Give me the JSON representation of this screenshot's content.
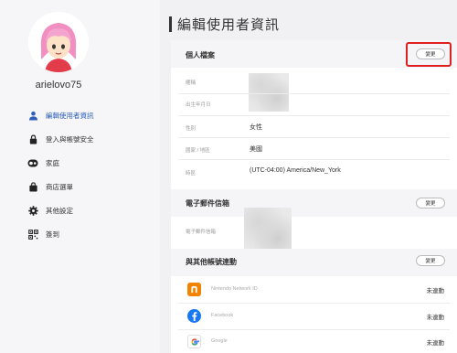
{
  "page_title": "編輯使用者資訊",
  "user": {
    "username": "arielovo75"
  },
  "sidebar": {
    "items": [
      {
        "label": "編輯使用者資訊",
        "icon": "user-icon",
        "active": true
      },
      {
        "label": "登入與帳號安全",
        "icon": "lock-icon",
        "active": false
      },
      {
        "label": "家庭",
        "icon": "family-icon",
        "active": false
      },
      {
        "label": "商店選單",
        "icon": "shopping-bag-icon",
        "active": false
      },
      {
        "label": "其他設定",
        "icon": "gear-icon",
        "active": false
      },
      {
        "label": "簽到",
        "icon": "qr-code-icon",
        "active": false
      }
    ]
  },
  "profile": {
    "title": "個人檔案",
    "edit_label": "變更",
    "rows": [
      {
        "label": "暱稱",
        "value": ""
      },
      {
        "label": "出生年月日",
        "value": ""
      },
      {
        "label": "性別",
        "value": "女性"
      },
      {
        "label": "國家 / 地區",
        "value": "美國"
      },
      {
        "label": "時區",
        "value": "(UTC-04:00) America/New_York"
      }
    ]
  },
  "email": {
    "title": "電子郵件信箱",
    "edit_label": "變更",
    "label": "電子郵件信箱"
  },
  "linked": {
    "title": "與其他帳號連動",
    "edit_label": "變更",
    "accounts": [
      {
        "name": "Nintendo Network ID",
        "status": "未連動",
        "color": "#f08300",
        "icon": "nintendo-network-icon"
      },
      {
        "name": "Facebook",
        "status": "未連動",
        "color": "#1877f2",
        "icon": "facebook-icon"
      },
      {
        "name": "Google",
        "status": "未連動",
        "color": "#ffffff",
        "icon": "google-icon"
      }
    ]
  },
  "colors": {
    "accent": "#2d5fb8",
    "highlight": "#e02020"
  }
}
